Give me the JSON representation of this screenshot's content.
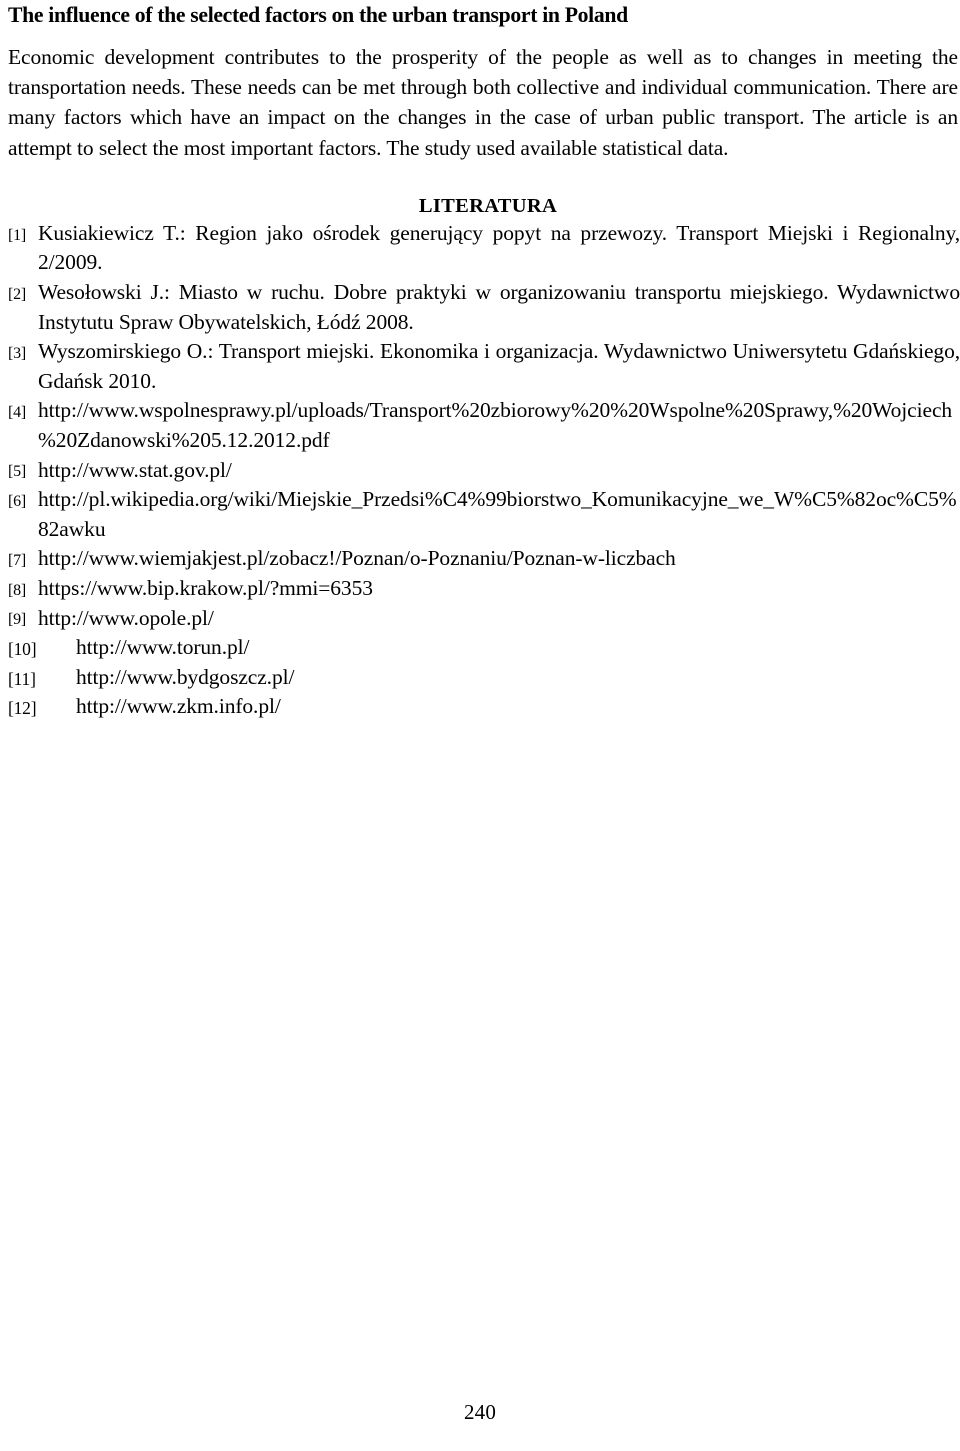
{
  "document": {
    "title": "The influence of the selected factors on the urban transport in Poland",
    "abstract": "Economic development contributes to the prosperity of the people as well as to changes in meeting the transportation needs. These needs can be met through both collective and individual communication. There are many factors which have an impact on the changes in the case of urban public transport. The article is an attempt to select the most important factors. The study used available statistical data.",
    "references_heading": "LITERATURA",
    "references": [
      {
        "number": "[1]",
        "text": "Kusiakiewicz T.: Region jako ośrodek generujący popyt na przewozy. Transport Miejski i Regionalny, 2/2009."
      },
      {
        "number": "[2]",
        "text": "Wesołowski J.: Miasto w ruchu. Dobre praktyki w organizowaniu transportu miejskiego. Wydawnictwo Instytutu Spraw Obywatelskich, Łódź 2008."
      },
      {
        "number": "[3]",
        "text": "Wyszomirskiego O.: Transport miejski. Ekonomika i organizacja. Wydawnictwo Uniwersytetu Gdańskiego, Gdańsk 2010."
      },
      {
        "number": "[4]",
        "text": "http://www.wspolnesprawy.pl/uploads/Transport%20zbiorowy%20%20Wspolne%20Sprawy,%20Wojciech%20Zdanowski%205.12.2012.pdf"
      },
      {
        "number": "[5]",
        "text": "http://www.stat.gov.pl/"
      },
      {
        "number": "[6]",
        "text": "http://pl.wikipedia.org/wiki/Miejskie_Przedsi%C4%99biorstwo_Komunikacyjne_we_W%C5%82oc%C5%82awku"
      },
      {
        "number": "[7]",
        "text": "http://www.wiemjakjest.pl/zobacz!/Poznan/o-Poznaniu/Poznan-w-liczbach"
      },
      {
        "number": "[8]",
        "text": "https://www.bip.krakow.pl/?mmi=6353"
      },
      {
        "number": "[9]",
        "text": "http://www.opole.pl/"
      },
      {
        "number": "[10]",
        "text": "http://www.torun.pl/"
      },
      {
        "number": "[11]",
        "text": "http://www.bydgoszcz.pl/"
      },
      {
        "number": "[12]",
        "text": "http://www.zkm.info.pl/"
      }
    ],
    "page_number": "240"
  }
}
